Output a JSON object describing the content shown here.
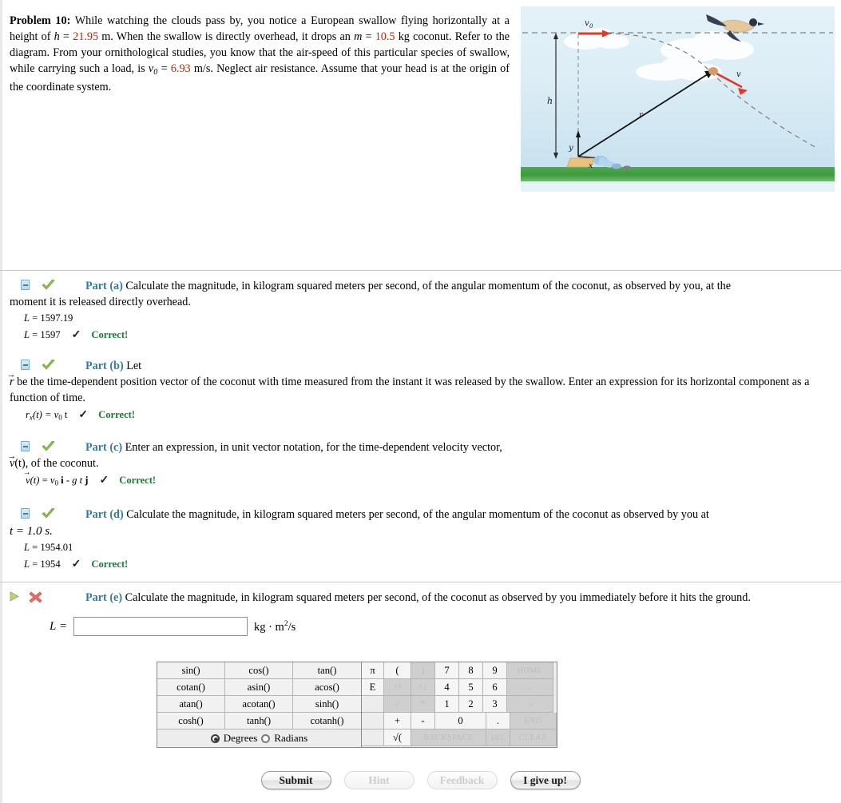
{
  "problem": {
    "label": "Problem 10:",
    "line1_a": "While watching the clouds pass by, you notice a European swallow flying horizontally at a height of ",
    "h_sym": "h",
    "h_eq": " = ",
    "h_val": "21.95",
    "h_unit": " m",
    "line1_b": ". When the swallow is directly overhead, it drops an ",
    "m_sym": "m",
    "m_val": "10.5",
    "m_unit": " kg",
    "line2": " coconut. Refer to the diagram. From your ornithological studies, you know that the air-speed of this particular species of swallow, while carrying such a load, is ",
    "v0_sym": "v",
    "v0_sub": "0",
    "v0_val": "6.93",
    "v0_unit": " m/s",
    "line3": ". Neglect air resistance. Assume that your head is at the origin of the coordinate system."
  },
  "figure": {
    "label_v0": "v",
    "label_v0_sub": "0",
    "label_h": "h",
    "label_y": "y",
    "label_x": "x",
    "label_r": "r",
    "label_v": "v",
    "sky_color": "#dcedf6",
    "ground_color": "#45a045",
    "arrow_color": "#e03a24",
    "vector_color": "#1a1a1a"
  },
  "parts": [
    {
      "id": "a",
      "title": "Part (a)",
      "status": "correct",
      "text": "Calculate the magnitude, in kilogram squared meters per second, of the angular momentum of the coconut, as observed by you, at the",
      "text_cont": "moment it is released directly overhead.",
      "answers": [
        {
          "lhs": "L",
          "eq": " = ",
          "value": "1597.19",
          "correct_label": ""
        },
        {
          "lhs": "L",
          "eq": " = ",
          "value": "1597",
          "correct_label": "Correct!"
        }
      ]
    },
    {
      "id": "b",
      "title": "Part (b)",
      "status": "correct",
      "text": "Let",
      "text_cont": " be the time-dependent position vector of the coconut with time measured from the instant it was released by the swallow. Enter an expression for its horizontal component as a function of time.",
      "vec_symbol": "r",
      "answers": [
        {
          "expr_lhs": "r",
          "expr_sub": "x",
          "expr_rest": "(t) = v",
          "expr_rest_sub": "0",
          "expr_tail": " t",
          "correct_label": "Correct!"
        }
      ]
    },
    {
      "id": "c",
      "title": "Part (c)",
      "status": "correct",
      "text": "Enter an expression, in unit vector notation, for the time-dependent velocity vector,",
      "text_cont": "(t), of the coconut.",
      "vec_symbol": "v",
      "answers": [
        {
          "expr_full": "v(t) = v0 i - g t j",
          "correct_label": "Correct!"
        }
      ]
    },
    {
      "id": "d",
      "title": "Part (d)",
      "status": "correct",
      "text": "Calculate the magnitude, in kilogram squared meters per second, of the angular momentum of the coconut as observed by you at",
      "text_cont": "t = 1.0 s.",
      "answers": [
        {
          "lhs": "L",
          "eq": " = ",
          "value": "1954.01",
          "correct_label": ""
        },
        {
          "lhs": "L",
          "eq": " = ",
          "value": "1954",
          "correct_label": "Correct!"
        }
      ]
    },
    {
      "id": "e",
      "title": "Part (e)",
      "status": "open",
      "text": "Calculate the magnitude, in kilogram squared meters per second, of the coconut as observed by you immediately before it hits the ground.",
      "text_cont": ""
    }
  ],
  "answer_field": {
    "label": "L =",
    "value": "",
    "placeholder": "",
    "unit_prefix": "kg · m",
    "unit_sup": "2",
    "unit_suffix": "/s"
  },
  "calculator": {
    "functions": [
      [
        "sin()",
        "cos()",
        "tan()"
      ],
      [
        "cotan()",
        "asin()",
        "acos()"
      ],
      [
        "atan()",
        "acotan()",
        "sinh()"
      ],
      [
        "cosh()",
        "tanh()",
        "cotanh()"
      ]
    ],
    "angle_mode": {
      "degrees_label": "Degrees",
      "radians_label": "Radians",
      "selected": "Degrees"
    },
    "keypad": [
      [
        {
          "label": "π",
          "w": "w1",
          "dis": false
        },
        {
          "label": "(",
          "w": "w2",
          "dis": false
        },
        {
          "label": ")",
          "w": "w3",
          "dis": true
        },
        {
          "label": "7",
          "w": "w3",
          "dis": false
        },
        {
          "label": "8",
          "w": "w3",
          "dis": false
        },
        {
          "label": "9",
          "w": "w3",
          "dis": false
        },
        {
          "label": "HOME",
          "w": "hom",
          "dis": true
        }
      ],
      [
        {
          "label": "E",
          "w": "w1",
          "dis": false
        },
        {
          "label": "↑²",
          "w": "w2",
          "dis": true
        },
        {
          "label": "^↓",
          "w": "w3",
          "dis": true
        },
        {
          "label": "4",
          "w": "w3",
          "dis": false
        },
        {
          "label": "5",
          "w": "w3",
          "dis": false
        },
        {
          "label": "6",
          "w": "w3",
          "dis": false
        },
        {
          "label": "←",
          "w": "hom",
          "dis": true
        }
      ],
      [
        {
          "label": "",
          "w": "w1",
          "dis": false,
          "blank": true
        },
        {
          "label": "/",
          "w": "w2",
          "dis": true
        },
        {
          "label": "*",
          "w": "w3",
          "dis": true
        },
        {
          "label": "1",
          "w": "w3",
          "dis": false
        },
        {
          "label": "2",
          "w": "w3",
          "dis": false
        },
        {
          "label": "3",
          "w": "w3",
          "dis": false
        },
        {
          "label": "→",
          "w": "hom",
          "dis": true
        }
      ],
      [
        {
          "label": "",
          "w": "w1",
          "dis": false,
          "blank": true
        },
        {
          "label": "+",
          "w": "w2",
          "dis": false
        },
        {
          "label": "-",
          "w": "w3",
          "dis": false
        },
        {
          "label": "0",
          "w": "wide",
          "dis": false
        },
        {
          "label": ".",
          "w": "w3",
          "dis": false
        },
        {
          "label": "END",
          "w": "hom",
          "dis": true
        }
      ],
      [
        {
          "label": "",
          "w": "w1",
          "dis": false,
          "blank": true
        },
        {
          "label": "√(",
          "w": "w2",
          "dis": false
        },
        {
          "label": "BACKSPACE",
          "w": "bsp",
          "dis": true
        },
        {
          "label": "DEL",
          "w": "del",
          "dis": true
        },
        {
          "label": "CLEAR",
          "w": "hom",
          "dis": true
        }
      ]
    ]
  },
  "buttons": [
    {
      "label": "Submit",
      "disabled": false
    },
    {
      "label": "Hint",
      "disabled": true
    },
    {
      "label": "Feedback",
      "disabled": true
    },
    {
      "label": "I give up!",
      "disabled": false
    }
  ]
}
